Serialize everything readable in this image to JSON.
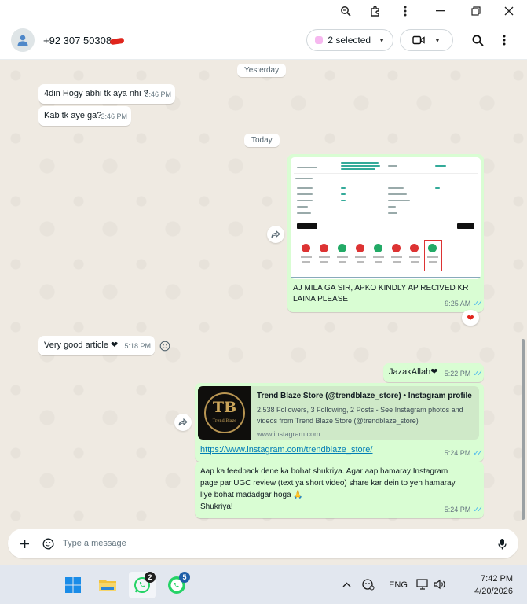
{
  "contact": {
    "name": "+92 307 50308"
  },
  "header": {
    "selected_label": "2 selected"
  },
  "chat": {
    "date_yesterday": "Yesterday",
    "date_today": "Today",
    "messages": [
      {
        "text": "4din Hogy abhi tk aya nhi ?",
        "time": "3:46 PM"
      },
      {
        "text": "Kab tk aye ga?",
        "time": "3:46 PM"
      },
      {
        "text": "AJ MILA GA SIR, APKO KINDLY AP RECIVED KR LAINA PLEASE",
        "time": "9:25 AM",
        "reaction": "❤"
      },
      {
        "text": "Very good article ❤",
        "time": "5:18 PM"
      },
      {
        "text": "JazakAllah❤",
        "time": "5:22 PM"
      },
      {
        "link": "https://www.instagram.com/trendblaze_store/",
        "time": "5:24 PM"
      },
      {
        "text_lines": [
          "Aap ka feedback dene ka bohat shukriya. Agar aap hamaray Instagram",
          "page par UGC review (text ya short video) share kar dein to yeh hamaray",
          "liye bohat madadgar hoga 🙏",
          "Shukriya!"
        ],
        "time": "5:24 PM"
      }
    ],
    "preview": {
      "title": "Trend Blaze Store (@trendblaze_store) • Instagram profile",
      "desc_line1": "2,538 Followers, 3 Following, 2 Posts - See Instagram photos and",
      "desc_line2": "videos from Trend Blaze Store (@trendblaze_store)",
      "domain": "www.instagram.com",
      "logo_text": "TB",
      "logo_caption": "Trend Blaze"
    }
  },
  "composer": {
    "placeholder": "Type a message"
  },
  "taskbar": {
    "badge_whatsapp": "2",
    "badge_business": "5",
    "language": "ENG",
    "time": "7:42 PM",
    "date": "4/20/2026"
  },
  "colors": {
    "outgoing": "#d9fdd3",
    "incoming": "#ffffff",
    "accent": "#25d366",
    "tick": "#53bdeb"
  }
}
